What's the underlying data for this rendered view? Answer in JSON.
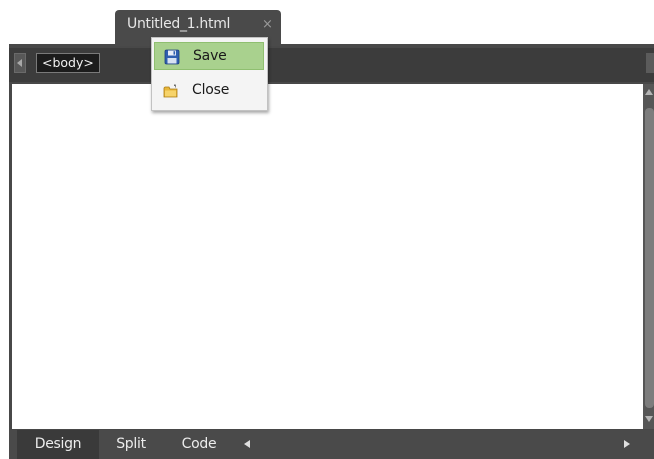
{
  "document_tab": {
    "title": "Untitled_1.html",
    "close_symbol": "×"
  },
  "breadcrumb": {
    "current_tag": "<body>"
  },
  "context_menu": {
    "items": [
      {
        "label": "Save",
        "icon": "save-floppy-icon",
        "highlighted": true
      },
      {
        "label": "Close",
        "icon": "close-folder-icon",
        "highlighted": false
      }
    ]
  },
  "view_tabs": {
    "design": "Design",
    "split": "Split",
    "code": "Code",
    "active": "Design"
  },
  "colors": {
    "frame": "#484848",
    "menu_highlight": "#a9d18e",
    "editor_background": "#ffffff"
  }
}
